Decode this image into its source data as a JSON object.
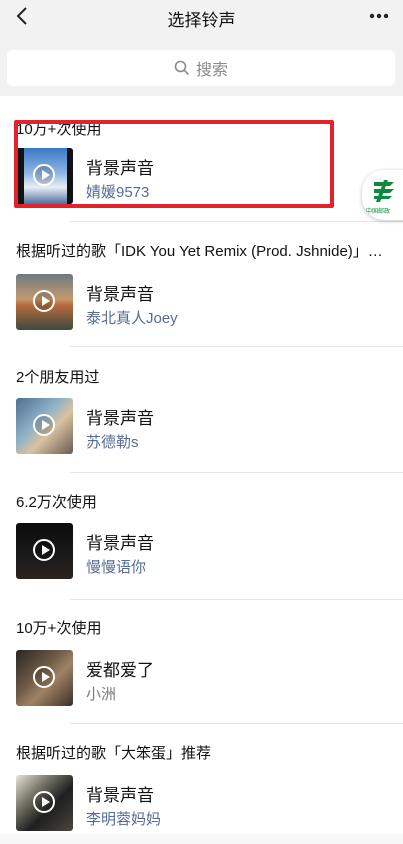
{
  "header": {
    "title": "选择铃声",
    "back_icon": "chevron-left-icon",
    "more_icon": "more-dots-icon"
  },
  "search": {
    "placeholder": "搜索",
    "icon": "search-icon"
  },
  "sections": [
    {
      "header": "10万+次使用",
      "song": "背景声音",
      "artist": "婧媛9573",
      "artist_color": "#576b95"
    },
    {
      "header": "根据听过的歌「IDK You Yet Remix (Prod. Jshnide)」…",
      "song": "背景声音",
      "artist": "泰北真人Joey",
      "artist_color": "#576b95"
    },
    {
      "header": "2个朋友用过",
      "song": "背景声音",
      "artist": "苏德勒s",
      "artist_color": "#576b95"
    },
    {
      "header": "6.2万次使用",
      "song": "背景声音",
      "artist": "慢慢语你",
      "artist_color": "#576b95"
    },
    {
      "header": "10万+次使用",
      "song": "爱都爱了",
      "artist": "小洲",
      "artist_color": "#7a7a7a"
    },
    {
      "header": "根据听过的歌「大笨蛋」推荐",
      "song": "背景声音",
      "artist": "李明蓉妈妈",
      "artist_color": "#576b95"
    }
  ],
  "overlay": {
    "badge_text": "中国邮政",
    "highlight_color": "#e3232b"
  }
}
